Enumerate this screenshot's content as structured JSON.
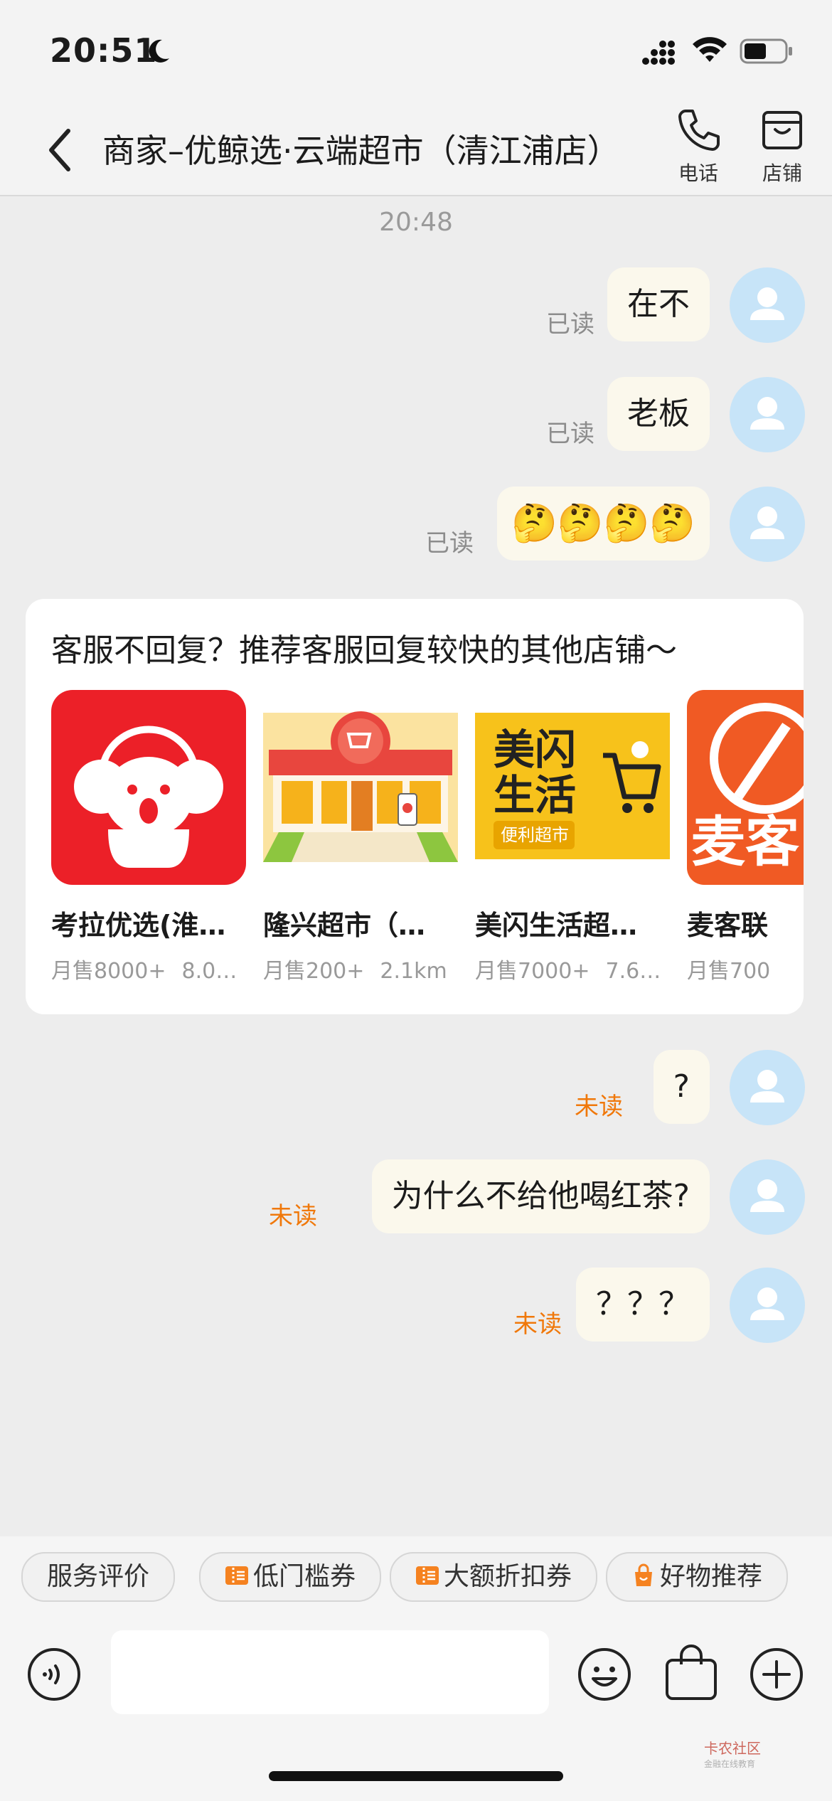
{
  "status_bar": {
    "time": "20:51"
  },
  "header": {
    "back_icon": "chevron-left-icon",
    "title": "商家–优鲸选·云端超市（清江浦店）",
    "call_label": "电话",
    "shop_label": "店铺"
  },
  "timestamp": "20:48",
  "messages_before": [
    {
      "text": "在不",
      "status": "已读"
    },
    {
      "text": "老板",
      "status": "已读"
    },
    {
      "text": "🤔🤔🤔🤔",
      "status": "已读"
    }
  ],
  "recommendation": {
    "title": "客服不回复？推荐客服回复较快的其他店铺～",
    "shops": [
      {
        "name": "考拉优选(淮…",
        "sales": "月售8000+",
        "distance": "8.0…"
      },
      {
        "name": "隆兴超市（…",
        "sales": "月售200+",
        "distance": "2.1km"
      },
      {
        "name": "美闪生活超…",
        "sales": "月售7000+",
        "distance": "7.6…",
        "logo_text_1": "美闪",
        "logo_text_2": "生活",
        "logo_tag": "便利超市"
      },
      {
        "name": "麦客联",
        "sales": "月售700",
        "distance": "",
        "logo_text": "麦客"
      }
    ]
  },
  "messages_after": [
    {
      "text": "?",
      "status": "未读"
    },
    {
      "text": "为什么不给他喝红茶?",
      "status": "未读"
    },
    {
      "text": "？？？",
      "status": "未读"
    }
  ],
  "quick_actions": [
    "服务评价",
    "低门槛券",
    "大额折扣券",
    "好物推荐"
  ],
  "input": {
    "placeholder": ""
  },
  "watermark": {
    "text": "卡农社区",
    "sub": "金融在线教育"
  },
  "colors": {
    "unread": "#f0780a",
    "avatar": "#c7e4f8",
    "bubble": "#fbf8ec",
    "background": "#ededed"
  }
}
